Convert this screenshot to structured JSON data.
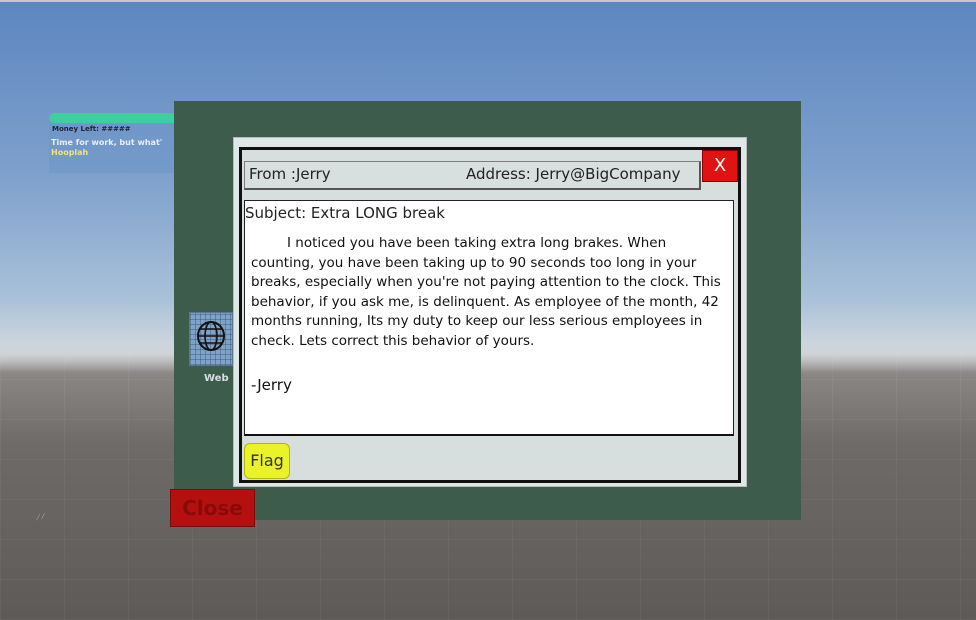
{
  "hud": {
    "money_label": "Money Left: #####",
    "task_text": "Time for work, but what'",
    "sub_text": "Hooplah"
  },
  "desktop": {
    "web_label": "Web",
    "close_label": "Close"
  },
  "email": {
    "from": "From :Jerry",
    "address": "Address: Jerry@BigCompany",
    "close_x": "X",
    "subject": "Subject: Extra LONG break",
    "body": "I noticed you have been taking extra long brakes. When counting, you have been taking up to 90 seconds too long in your breaks, especially when you're not paying attention to the clock. This behavior, if you ask me, is delinquent. As employee of the month, 42 months running, Its my duty to keep our less serious employees in check. Lets correct this behavior of yours.",
    "signature": "-Jerry",
    "flag_label": "Flag"
  },
  "colors": {
    "screen": "#3d5c4c",
    "close_button": "#b51010",
    "x_button": "#e01212",
    "flag_button": "#eaf22a",
    "hud_bar": "#3ecf9c"
  }
}
